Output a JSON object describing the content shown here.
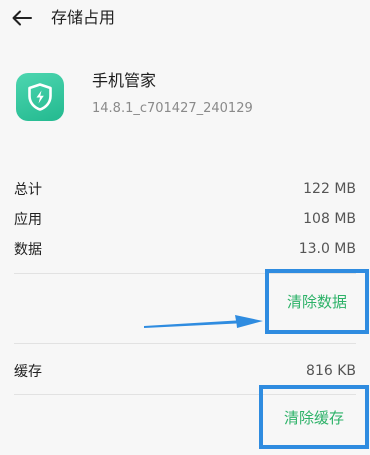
{
  "header": {
    "title": "存储占用",
    "back_icon": "arrow-left-icon"
  },
  "app": {
    "name": "手机管家",
    "version": "14.8.1_c701427_240129",
    "icon": "shield-lightning-icon",
    "icon_color": "#2ec49a"
  },
  "storage": {
    "rows": [
      {
        "label": "总计",
        "value": "122 MB"
      },
      {
        "label": "应用",
        "value": "108 MB"
      },
      {
        "label": "数据",
        "value": "13.0 MB"
      }
    ],
    "clear_data_label": "清除数据",
    "cache": {
      "label": "缓存",
      "value": "816 KB"
    },
    "clear_cache_label": "清除缓存"
  },
  "colors": {
    "action_text": "#2db268",
    "highlight_box": "#2f8ce0",
    "annotation_arrow": "#2f8ce0"
  }
}
